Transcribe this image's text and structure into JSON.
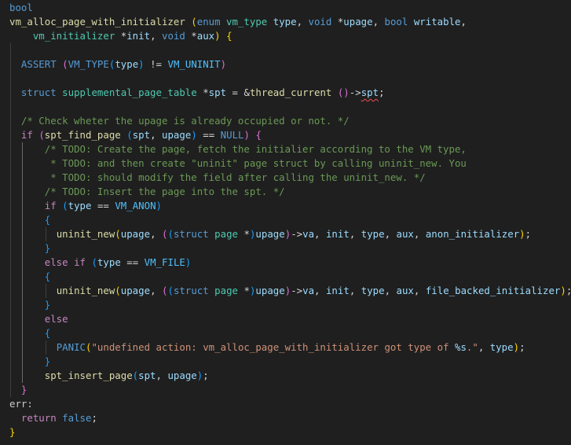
{
  "editor": {
    "language": "c",
    "squiggle_color": "#f14c4c",
    "bracket_colors": [
      "#ffd700",
      "#da70d6",
      "#179fff"
    ],
    "lines": [
      {
        "indent": 0,
        "tokens": [
          [
            "t-kw",
            "bool"
          ]
        ]
      },
      {
        "indent": 0,
        "tokens": [
          [
            "t-fn",
            "vm_alloc_page_with_initializer"
          ],
          [
            "t-punc",
            " "
          ],
          [
            "p1",
            "("
          ],
          [
            "t-kw",
            "enum"
          ],
          [
            "t-punc",
            " "
          ],
          [
            "t-type",
            "vm_type"
          ],
          [
            "t-punc",
            " "
          ],
          [
            "t-param",
            "type"
          ],
          [
            "t-punc",
            ", "
          ],
          [
            "t-kw",
            "void"
          ],
          [
            "t-punc",
            " "
          ],
          [
            "t-op",
            "*"
          ],
          [
            "t-param",
            "upage"
          ],
          [
            "t-punc",
            ", "
          ],
          [
            "t-kw",
            "bool"
          ],
          [
            "t-punc",
            " "
          ],
          [
            "t-param",
            "writable"
          ],
          [
            "t-punc",
            ","
          ]
        ]
      },
      {
        "indent": 4,
        "tokens": [
          [
            "t-type",
            "vm_initializer"
          ],
          [
            "t-punc",
            " "
          ],
          [
            "t-op",
            "*"
          ],
          [
            "t-param",
            "init"
          ],
          [
            "t-punc",
            ", "
          ],
          [
            "t-kw",
            "void"
          ],
          [
            "t-punc",
            " "
          ],
          [
            "t-op",
            "*"
          ],
          [
            "t-param",
            "aux"
          ],
          [
            "p1",
            ")"
          ],
          [
            "t-punc",
            " "
          ],
          [
            "p1",
            "{"
          ]
        ]
      },
      {
        "indent": 0,
        "tokens": []
      },
      {
        "indent": 2,
        "tokens": [
          [
            "t-macro",
            "ASSERT"
          ],
          [
            "t-punc",
            " "
          ],
          [
            "p2",
            "("
          ],
          [
            "t-macro",
            "VM_TYPE"
          ],
          [
            "p3",
            "("
          ],
          [
            "t-var",
            "type"
          ],
          [
            "p3",
            ")"
          ],
          [
            "t-punc",
            " "
          ],
          [
            "t-op",
            "!="
          ],
          [
            "t-punc",
            " "
          ],
          [
            "t-const",
            "VM_UNINIT"
          ],
          [
            "p2",
            ")"
          ]
        ]
      },
      {
        "indent": 0,
        "tokens": []
      },
      {
        "indent": 2,
        "tokens": [
          [
            "t-kw",
            "struct"
          ],
          [
            "t-punc",
            " "
          ],
          [
            "t-type",
            "supplemental_page_table"
          ],
          [
            "t-punc",
            " "
          ],
          [
            "t-op",
            "*"
          ],
          [
            "t-var",
            "spt"
          ],
          [
            "t-punc",
            " "
          ],
          [
            "t-op",
            "="
          ],
          [
            "t-punc",
            " "
          ],
          [
            "t-op",
            "&"
          ],
          [
            "t-fn",
            "thread_current"
          ],
          [
            "t-punc",
            " "
          ],
          [
            "p2",
            "()"
          ],
          [
            "t-op",
            "->"
          ],
          [
            "t-var squiggle",
            "spt"
          ],
          [
            "t-punc",
            ";"
          ]
        ]
      },
      {
        "indent": 0,
        "tokens": []
      },
      {
        "indent": 2,
        "tokens": [
          [
            "t-cmt",
            "/* Check wheter the upage is already occupied or not. */"
          ]
        ]
      },
      {
        "indent": 2,
        "tokens": [
          [
            "t-ctrl",
            "if"
          ],
          [
            "t-punc",
            " "
          ],
          [
            "p2",
            "("
          ],
          [
            "t-fn",
            "spt_find_page"
          ],
          [
            "t-punc",
            " "
          ],
          [
            "p3",
            "("
          ],
          [
            "t-var",
            "spt"
          ],
          [
            "t-punc",
            ", "
          ],
          [
            "t-var",
            "upage"
          ],
          [
            "p3",
            ")"
          ],
          [
            "t-punc",
            " "
          ],
          [
            "t-op",
            "=="
          ],
          [
            "t-punc",
            " "
          ],
          [
            "t-macro",
            "NULL"
          ],
          [
            "p2",
            ")"
          ],
          [
            "t-punc",
            " "
          ],
          [
            "p2",
            "{"
          ]
        ]
      },
      {
        "indent": 6,
        "tokens": [
          [
            "t-cmt",
            "/* TODO: Create the page, fetch the initialier according to the VM type,"
          ]
        ]
      },
      {
        "indent": 6,
        "tokens": [
          [
            "t-cmt",
            " * TODO: and then create \"uninit\" page struct by calling uninit_new. You"
          ]
        ]
      },
      {
        "indent": 6,
        "tokens": [
          [
            "t-cmt",
            " * TODO: should modify the field after calling the uninit_new. */"
          ]
        ]
      },
      {
        "indent": 6,
        "tokens": [
          [
            "t-cmt",
            "/* TODO: Insert the page into the spt. */"
          ]
        ]
      },
      {
        "indent": 6,
        "tokens": [
          [
            "t-ctrl",
            "if"
          ],
          [
            "t-punc",
            " "
          ],
          [
            "p3",
            "("
          ],
          [
            "t-var",
            "type"
          ],
          [
            "t-punc",
            " "
          ],
          [
            "t-op",
            "=="
          ],
          [
            "t-punc",
            " "
          ],
          [
            "t-const",
            "VM_ANON"
          ],
          [
            "p3",
            ")"
          ]
        ]
      },
      {
        "indent": 6,
        "tokens": [
          [
            "p3",
            "{"
          ]
        ]
      },
      {
        "indent": 8,
        "tokens": [
          [
            "t-fn",
            "uninit_new"
          ],
          [
            "p1",
            "("
          ],
          [
            "t-var",
            "upage"
          ],
          [
            "t-punc",
            ", "
          ],
          [
            "p2",
            "("
          ],
          [
            "p3",
            "("
          ],
          [
            "t-kw",
            "struct"
          ],
          [
            "t-punc",
            " "
          ],
          [
            "t-type",
            "page"
          ],
          [
            "t-punc",
            " "
          ],
          [
            "t-op",
            "*"
          ],
          [
            "p3",
            ")"
          ],
          [
            "t-var",
            "upage"
          ],
          [
            "p2",
            ")"
          ],
          [
            "t-op",
            "->"
          ],
          [
            "t-var",
            "va"
          ],
          [
            "t-punc",
            ", "
          ],
          [
            "t-var",
            "init"
          ],
          [
            "t-punc",
            ", "
          ],
          [
            "t-var",
            "type"
          ],
          [
            "t-punc",
            ", "
          ],
          [
            "t-var",
            "aux"
          ],
          [
            "t-punc",
            ", "
          ],
          [
            "t-var",
            "anon_initializer"
          ],
          [
            "p1",
            ")"
          ],
          [
            "t-punc",
            ";"
          ]
        ]
      },
      {
        "indent": 6,
        "tokens": [
          [
            "p3",
            "}"
          ]
        ]
      },
      {
        "indent": 6,
        "tokens": [
          [
            "t-ctrl",
            "else"
          ],
          [
            "t-punc",
            " "
          ],
          [
            "t-ctrl",
            "if"
          ],
          [
            "t-punc",
            " "
          ],
          [
            "p3",
            "("
          ],
          [
            "t-var",
            "type"
          ],
          [
            "t-punc",
            " "
          ],
          [
            "t-op",
            "=="
          ],
          [
            "t-punc",
            " "
          ],
          [
            "t-const",
            "VM_FILE"
          ],
          [
            "p3",
            ")"
          ]
        ]
      },
      {
        "indent": 6,
        "tokens": [
          [
            "p3",
            "{"
          ]
        ]
      },
      {
        "indent": 8,
        "tokens": [
          [
            "t-fn",
            "uninit_new"
          ],
          [
            "p1",
            "("
          ],
          [
            "t-var",
            "upage"
          ],
          [
            "t-punc",
            ", "
          ],
          [
            "p2",
            "("
          ],
          [
            "p3",
            "("
          ],
          [
            "t-kw",
            "struct"
          ],
          [
            "t-punc",
            " "
          ],
          [
            "t-type",
            "page"
          ],
          [
            "t-punc",
            " "
          ],
          [
            "t-op",
            "*"
          ],
          [
            "p3",
            ")"
          ],
          [
            "t-var",
            "upage"
          ],
          [
            "p2",
            ")"
          ],
          [
            "t-op",
            "->"
          ],
          [
            "t-var",
            "va"
          ],
          [
            "t-punc",
            ", "
          ],
          [
            "t-var",
            "init"
          ],
          [
            "t-punc",
            ", "
          ],
          [
            "t-var",
            "type"
          ],
          [
            "t-punc",
            ", "
          ],
          [
            "t-var",
            "aux"
          ],
          [
            "t-punc",
            ", "
          ],
          [
            "t-var",
            "file_backed_initializer"
          ],
          [
            "p1",
            ")"
          ],
          [
            "t-punc",
            ";"
          ]
        ]
      },
      {
        "indent": 6,
        "tokens": [
          [
            "p3",
            "}"
          ]
        ]
      },
      {
        "indent": 6,
        "tokens": [
          [
            "t-ctrl",
            "else"
          ]
        ]
      },
      {
        "indent": 6,
        "tokens": [
          [
            "p3",
            "{"
          ]
        ]
      },
      {
        "indent": 8,
        "tokens": [
          [
            "t-macro",
            "PANIC"
          ],
          [
            "p1",
            "("
          ],
          [
            "t-str",
            "\"undefined action: vm_alloc_page_with_initializer got type of "
          ],
          [
            "t-fmt",
            "%s"
          ],
          [
            "t-str",
            ".\""
          ],
          [
            "t-punc",
            ", "
          ],
          [
            "t-var",
            "type"
          ],
          [
            "p1",
            ")"
          ],
          [
            "t-punc",
            ";"
          ]
        ]
      },
      {
        "indent": 6,
        "tokens": [
          [
            "p3",
            "}"
          ]
        ]
      },
      {
        "indent": 6,
        "tokens": [
          [
            "t-fn",
            "spt_insert_page"
          ],
          [
            "p3",
            "("
          ],
          [
            "t-var",
            "spt"
          ],
          [
            "t-punc",
            ", "
          ],
          [
            "t-var",
            "upage"
          ],
          [
            "p3",
            ")"
          ],
          [
            "t-punc",
            ";"
          ]
        ]
      },
      {
        "indent": 2,
        "tokens": [
          [
            "p2",
            "}"
          ]
        ]
      },
      {
        "indent": 0,
        "tokens": [
          [
            "t-label",
            "err:"
          ]
        ]
      },
      {
        "indent": 2,
        "tokens": [
          [
            "t-ctrl",
            "return"
          ],
          [
            "t-punc",
            " "
          ],
          [
            "t-kw",
            "false"
          ],
          [
            "t-punc",
            ";"
          ]
        ]
      },
      {
        "indent": 0,
        "tokens": [
          [
            "p1",
            "}"
          ]
        ]
      }
    ]
  }
}
